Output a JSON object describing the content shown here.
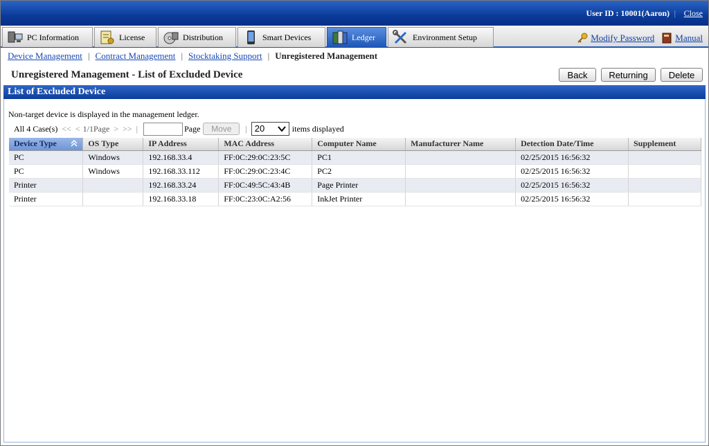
{
  "topbar": {
    "user_text": "User ID : 10001(Aaron)",
    "separator": "|",
    "close_label": "Close"
  },
  "tabs": [
    {
      "label": "PC Information",
      "icon": "pc-icon",
      "active": false
    },
    {
      "label": "License",
      "icon": "license-icon",
      "active": false
    },
    {
      "label": "Distribution",
      "icon": "distribution-icon",
      "active": false
    },
    {
      "label": "Smart Devices",
      "icon": "smart-device-icon",
      "active": false
    },
    {
      "label": "Ledger",
      "icon": "ledger-icon",
      "active": true
    },
    {
      "label": "Environment Setup",
      "icon": "tools-icon",
      "active": false
    }
  ],
  "rightlinks": {
    "modify_password": "Modify Password",
    "manual": "Manual"
  },
  "subnav": {
    "items": [
      "Device Management",
      "Contract Management",
      "Stocktaking Support"
    ],
    "current": "Unregistered Management",
    "separator": "|"
  },
  "page": {
    "title": "Unregistered Management - List of Excluded Device",
    "buttons": {
      "back": "Back",
      "returning": "Returning",
      "delete": "Delete"
    }
  },
  "section": {
    "title": "List of Excluded Device",
    "note": "Non-target device is displayed in the management ledger."
  },
  "pager": {
    "total": "All 4 Case(s)",
    "first": "<<",
    "prev": "<",
    "page_info": "1/1Page",
    "next": ">",
    "last": ">>",
    "separator": "|",
    "page_label": "Page",
    "move_label": "Move",
    "per_page": "20",
    "per_page_label": "items displayed"
  },
  "table": {
    "columns": [
      "Device Type",
      "OS Type",
      "IP Address",
      "MAC Address",
      "Computer Name",
      "Manufacturer Name",
      "Detection Date/Time",
      "Supplement"
    ],
    "rows": [
      [
        "PC",
        "Windows",
        "192.168.33.4",
        "FF:0C:29:0C:23:5C",
        "PC1",
        "",
        "02/25/2015 16:56:32",
        ""
      ],
      [
        "PC",
        "Windows",
        "192.168.33.112",
        "FF:0C:29:0C:23:4C",
        "PC2",
        "",
        "02/25/2015 16:56:32",
        ""
      ],
      [
        "Printer",
        "",
        "192.168.33.24",
        "FF:0C:49:5C:43:4B",
        "Page Printer",
        "",
        "02/25/2015 16:56:32",
        ""
      ],
      [
        "Printer",
        "",
        "192.168.33.18",
        "FF:0C:23:0C:A2:56",
        "InkJet Printer",
        "",
        "02/25/2015 16:56:32",
        ""
      ]
    ]
  },
  "colors": {
    "header_blue": "#0c3d9b",
    "link_blue": "#1a49b4",
    "active_tab": "#1d56b6"
  }
}
